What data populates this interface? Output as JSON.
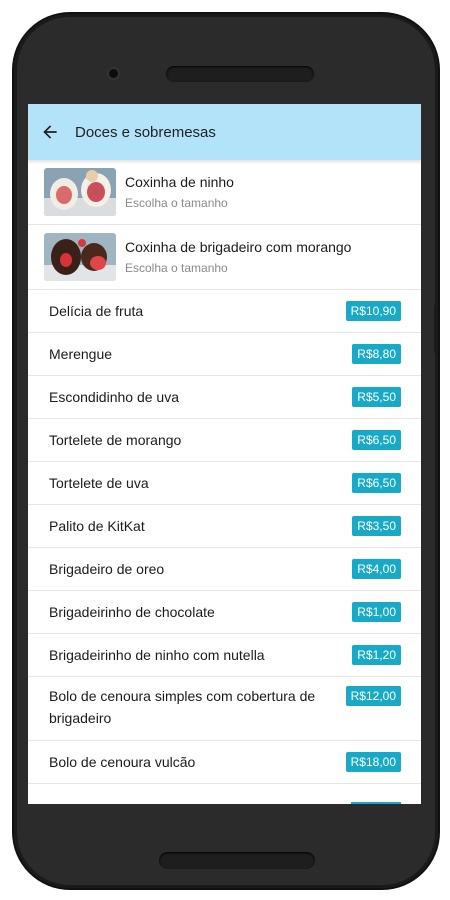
{
  "header": {
    "title": "Doces e sobremesas",
    "back_icon": "arrow-left-icon"
  },
  "featured": [
    {
      "name": "Coxinha de ninho",
      "subtitle": "Escolha o tamanho"
    },
    {
      "name": "Coxinha de brigadeiro com morango",
      "subtitle": "Escolha o tamanho"
    }
  ],
  "items": [
    {
      "name": "Delícia de fruta",
      "price": "R$10,90"
    },
    {
      "name": "Merengue",
      "price": "R$8,80"
    },
    {
      "name": "Escondidinho de uva",
      "price": "R$5,50"
    },
    {
      "name": "Tortelete de morango",
      "price": "R$6,50"
    },
    {
      "name": "Tortelete de uva",
      "price": "R$6,50"
    },
    {
      "name": "Palito de KitKat",
      "price": "R$3,50"
    },
    {
      "name": "Brigadeiro de oreo",
      "price": "R$4,00"
    },
    {
      "name": "Brigadeirinho de chocolate",
      "price": "R$1,00"
    },
    {
      "name": "Brigadeirinho de ninho com nutella",
      "price": "R$1,20"
    },
    {
      "name": "Bolo de cenoura simples com cobertura de brigadeiro",
      "price": "R$12,00"
    },
    {
      "name": "Bolo de cenoura vulcão",
      "price": "R$18,00"
    }
  ],
  "colors": {
    "appbar": "#b3e3f9",
    "price_badge": "#18a9c7",
    "phone_body": "#2b2b2b"
  }
}
